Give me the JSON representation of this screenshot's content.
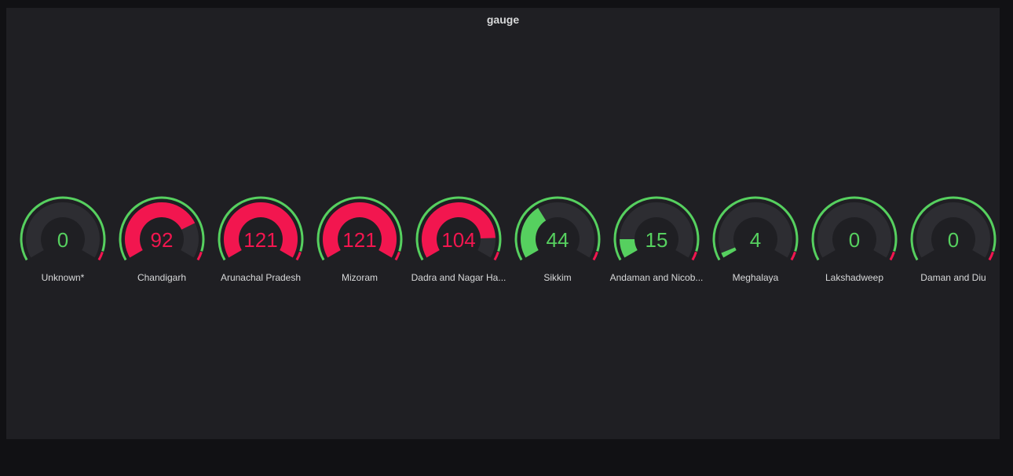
{
  "panel": {
    "title": "gauge"
  },
  "colors": {
    "ok": "#56d05f",
    "alert": "#f2164f",
    "track": "#2d2d32",
    "panel_bg": "#1f1f23",
    "page_bg": "#111114",
    "text": "#d8d9da"
  },
  "gauge_config": {
    "min": 0,
    "max": 120,
    "threshold_alert_from": 50
  },
  "gauges": [
    {
      "name": "Unknown*",
      "value": 0,
      "value_label": "0"
    },
    {
      "name": "Chandigarh",
      "value": 92,
      "value_label": "92"
    },
    {
      "name": "Arunachal Pradesh",
      "value": 121,
      "value_label": "121"
    },
    {
      "name": "Mizoram",
      "value": 121,
      "value_label": "121"
    },
    {
      "name": "Dadra and Nagar Ha...",
      "value": 104,
      "value_label": "104"
    },
    {
      "name": "Sikkim",
      "value": 44,
      "value_label": "44"
    },
    {
      "name": "Andaman and Nicob...",
      "value": 15,
      "value_label": "15"
    },
    {
      "name": "Meghalaya",
      "value": 4,
      "value_label": "4"
    },
    {
      "name": "Lakshadweep",
      "value": 0,
      "value_label": "0"
    },
    {
      "name": "Daman and Diu",
      "value": 0,
      "value_label": "0"
    }
  ]
}
